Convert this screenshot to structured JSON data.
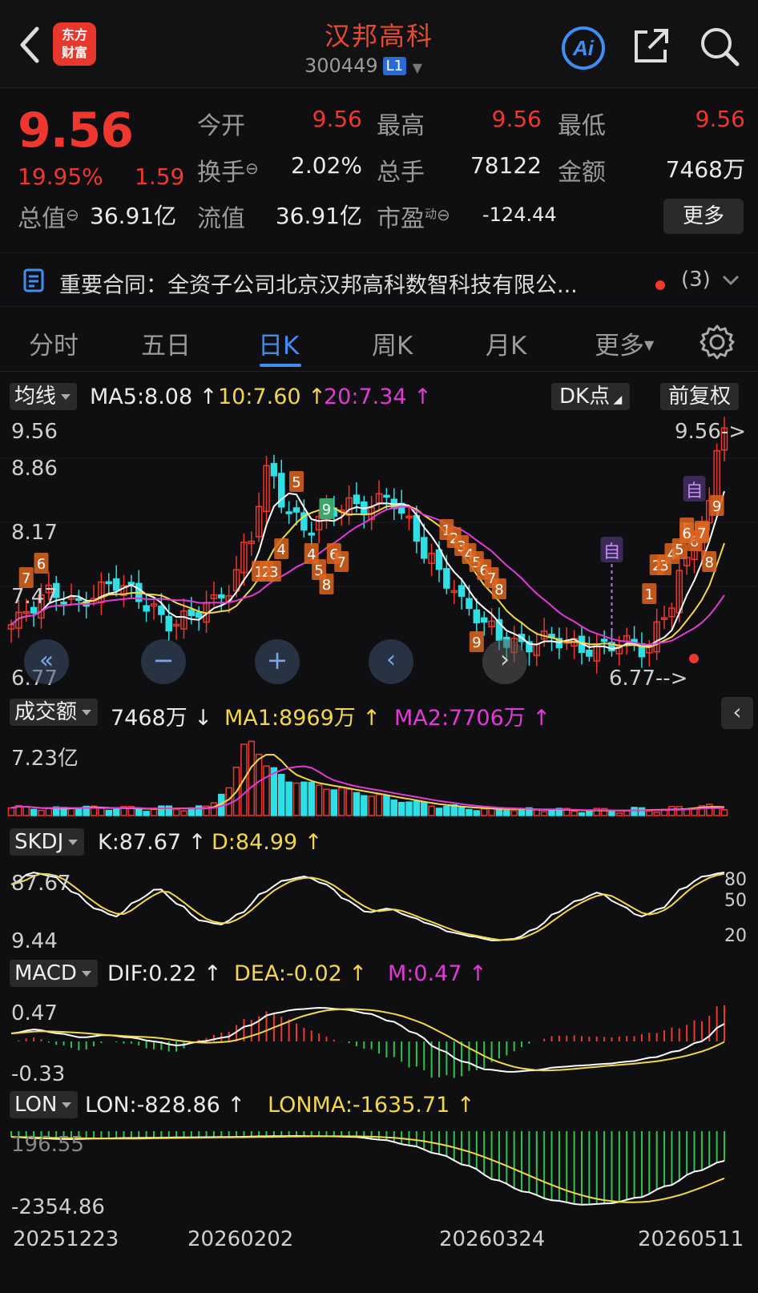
{
  "header": {
    "logo_text_1": "东方",
    "logo_text_2": "财富",
    "stock_name": "汉邦高科",
    "stock_code": "300449",
    "level": "L1"
  },
  "quote": {
    "price": "9.56",
    "change_pct": "19.95%",
    "change": "1.59",
    "open_label": "今开",
    "open": "9.56",
    "high_label": "最高",
    "high": "9.56",
    "low_label": "最低",
    "low": "9.56",
    "turnover_label": "换手",
    "turnover": "2.02%",
    "volume_label": "总手",
    "volume": "78122",
    "amount_label": "金额",
    "amount": "7468万",
    "mktcap_label": "总值",
    "mktcap": "36.91亿",
    "float_label": "流值",
    "float": "36.91亿",
    "pe_label": "市盈",
    "pe_sup": "动",
    "pe": "-124.44",
    "more": "更多"
  },
  "news": {
    "text": "重要合同：全资子公司北京汉邦高科数智科技有限公...",
    "count": "(3)"
  },
  "tabs": [
    "分时",
    "五日",
    "日K",
    "周K",
    "月K",
    "更多"
  ],
  "active_tab": "日K",
  "kline": {
    "indicator": "均线",
    "ma5": "MA5:8.08",
    "ma10": "10:7.60",
    "ma20": "20:7.34",
    "dk_button": "DK点",
    "adjust_button": "前复权",
    "axis_top": "9.56",
    "axis_2": "8.86",
    "axis_3": "8.17",
    "axis_4": "7.47",
    "axis_bottom": "6.77",
    "latest_label": "9.56->",
    "low_label": "6.77-->",
    "self_marker": "自",
    "self_marker_2": "自",
    "td_counts": [
      "7",
      "6",
      "5",
      "9",
      "4",
      "1",
      "2",
      "3",
      "4",
      "5",
      "6",
      "7",
      "8",
      "9",
      "5",
      "6",
      "7",
      "1",
      "2",
      "3",
      "4",
      "5",
      "6",
      "7",
      "8",
      "9",
      "1",
      "2",
      "3",
      "4",
      "5",
      "6",
      "7",
      "8"
    ]
  },
  "volume": {
    "indicator": "成交额",
    "value": "7468万",
    "ma1": "MA1:8969万",
    "ma2": "MA2:7706万",
    "axis_top": "7.23亿"
  },
  "skdj": {
    "indicator": "SKDJ",
    "k": "K:87.67",
    "d": "D:84.99",
    "axis_top": "87.67",
    "axis_bottom": "9.44",
    "lvl_80": "80",
    "lvl_50": "50",
    "lvl_20": "20"
  },
  "macd": {
    "indicator": "MACD",
    "dif": "DIF:0.22",
    "dea": "DEA:-0.02",
    "m": "M:0.47",
    "axis_top": "0.47",
    "axis_bottom": "-0.33"
  },
  "lon": {
    "indicator": "LON",
    "lon": "LON:-828.86",
    "lonma": "LONMA:-1635.71",
    "axis_top": "196.55",
    "axis_bottom": "-2354.86"
  },
  "dates": [
    "20251223",
    "20260202",
    "20260324",
    "20260511"
  ],
  "colors": {
    "up": "#f0372d",
    "down": "#2ee0e6",
    "ma5": "#ffffff",
    "ma10": "#f1d749",
    "ma20": "#e23ad6",
    "brand": "#e8382e",
    "active_tab": "#3f8ff0"
  }
}
